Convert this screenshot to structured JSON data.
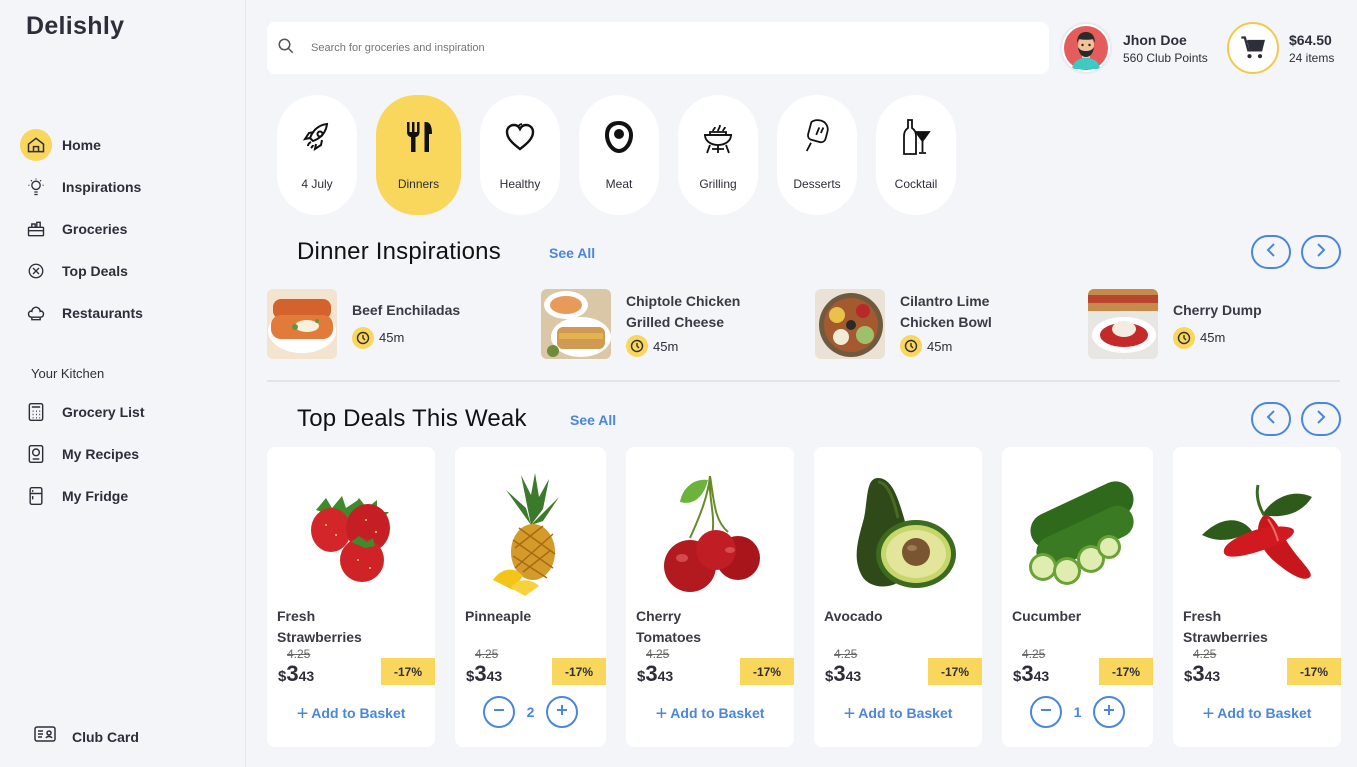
{
  "app": {
    "name": "Delishly"
  },
  "nav": {
    "items": [
      {
        "label": "Home",
        "icon": "home-icon",
        "active": true
      },
      {
        "label": "Inspirations",
        "icon": "bulb-icon"
      },
      {
        "label": "Groceries",
        "icon": "basket-icon"
      },
      {
        "label": "Top Deals",
        "icon": "deal-icon"
      },
      {
        "label": "Restaurants",
        "icon": "chef-hat-icon"
      }
    ],
    "section_label": "Your Kitchen",
    "kitchen": [
      {
        "label": "Grocery List",
        "icon": "calculator-icon"
      },
      {
        "label": "My Recipes",
        "icon": "recipe-book-icon"
      },
      {
        "label": "My Fridge",
        "icon": "fridge-icon"
      }
    ],
    "club_card": "Club Card"
  },
  "search": {
    "placeholder": "Search for groceries and inspiration"
  },
  "user": {
    "name": "Jhon Doe",
    "points": "560 Club Points"
  },
  "cart": {
    "total": "$64.50",
    "items": "24 items"
  },
  "categories": [
    {
      "label": "4 July",
      "icon": "rocket-icon"
    },
    {
      "label": "Dinners",
      "icon": "fork-knife-icon",
      "active": true
    },
    {
      "label": "Healthy",
      "icon": "heart-icon"
    },
    {
      "label": "Meat",
      "icon": "steak-icon"
    },
    {
      "label": "Grilling",
      "icon": "grill-icon"
    },
    {
      "label": "Desserts",
      "icon": "popsicle-icon"
    },
    {
      "label": "Cocktail",
      "icon": "cocktail-icon"
    }
  ],
  "inspirations": {
    "title": "Dinner Inspirations",
    "see_all": "See All",
    "items": [
      {
        "name_lines": [
          "Beef Enchiladas"
        ],
        "time": "45m"
      },
      {
        "name_lines": [
          "Chiptole Chicken",
          "Grilled Cheese"
        ],
        "time": "45m"
      },
      {
        "name_lines": [
          "Cilantro Lime",
          "Chicken Bowl"
        ],
        "time": "45m"
      },
      {
        "name_lines": [
          "Cherry Dump"
        ],
        "time": "45m"
      }
    ]
  },
  "deals": {
    "title": "Top Deals This Weak",
    "see_all": "See All",
    "add_label": "Add to Basket",
    "items": [
      {
        "name_lines": [
          "Fresh",
          "Strawberries"
        ],
        "old_price": "4.25",
        "currency": "$",
        "price_int": "3",
        "price_cents": "43",
        "badge": "-17%",
        "mode": "add"
      },
      {
        "name_lines": [
          "Pinneaple"
        ],
        "old_price": "4.25",
        "currency": "$",
        "price_int": "3",
        "price_cents": "43",
        "badge": "-17%",
        "mode": "qty",
        "qty": "2"
      },
      {
        "name_lines": [
          "Cherry",
          "Tomatoes"
        ],
        "old_price": "4.25",
        "currency": "$",
        "price_int": "3",
        "price_cents": "43",
        "badge": "-17%",
        "mode": "add"
      },
      {
        "name_lines": [
          "Avocado"
        ],
        "old_price": "4.25",
        "currency": "$",
        "price_int": "3",
        "price_cents": "43",
        "badge": "-17%",
        "mode": "add"
      },
      {
        "name_lines": [
          "Cucumber"
        ],
        "old_price": "4.25",
        "currency": "$",
        "price_int": "3",
        "price_cents": "43",
        "badge": "-17%",
        "mode": "qty",
        "qty": "1"
      },
      {
        "name_lines": [
          "Fresh",
          "Strawberries"
        ],
        "old_price": "4.25",
        "currency": "$",
        "price_int": "3",
        "price_cents": "43",
        "badge": "-17%",
        "mode": "add"
      }
    ]
  },
  "colors": {
    "accent": "#f9d65c",
    "link": "#4a86d9",
    "background": "#f4f5f9"
  }
}
